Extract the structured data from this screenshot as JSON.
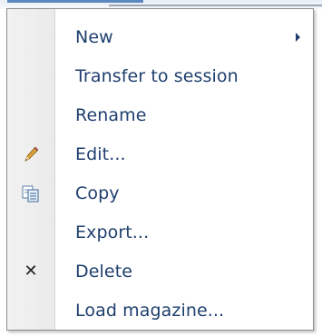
{
  "menu": {
    "items": [
      {
        "label": "New",
        "icon": "",
        "submenu": true
      },
      {
        "label": "Transfer to session",
        "icon": ""
      },
      {
        "label": "Rename",
        "icon": ""
      },
      {
        "label": "Edit...",
        "icon": "pencil-icon"
      },
      {
        "label": "Copy",
        "icon": "copy-icon"
      },
      {
        "label": "Export...",
        "icon": ""
      },
      {
        "label": "Delete",
        "icon": "delete-x-icon"
      },
      {
        "label": "Load magazine...",
        "icon": ""
      }
    ]
  }
}
